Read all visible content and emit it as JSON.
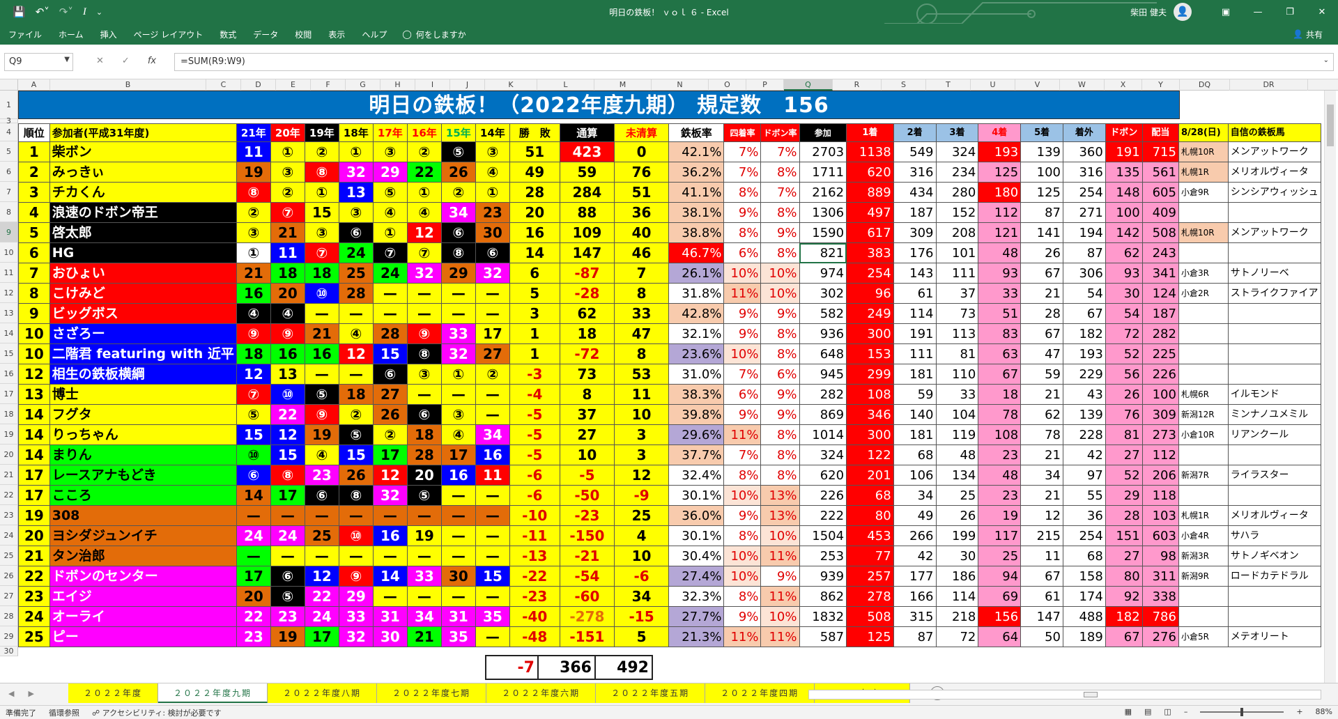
{
  "window": {
    "title": "明日の鉄板！ ｖｏｌ ６ - Excel",
    "user": "柴田 健夫",
    "qat_icons": [
      "save-icon",
      "undo-icon",
      "redo-icon",
      "italic-icon",
      "customize-icon"
    ]
  },
  "ribbon": {
    "tabs": [
      "ファイル",
      "ホーム",
      "挿入",
      "ページ レイアウト",
      "数式",
      "データ",
      "校閲",
      "表示",
      "ヘルプ"
    ],
    "tell_me": "何をしますか",
    "share": "共有"
  },
  "formula_bar": {
    "name_box": "Q9",
    "formula": "=SUM(R9:W9)"
  },
  "columns": [
    "A",
    "B",
    "C",
    "D",
    "E",
    "F",
    "G",
    "H",
    "I",
    "J",
    "K",
    "L",
    "M",
    "N",
    "O",
    "P",
    "Q",
    "R",
    "S",
    "T",
    "U",
    "V",
    "W",
    "X",
    "Y",
    "DQ",
    "DR"
  ],
  "rows": [
    "1",
    "3",
    "4",
    "5",
    "6",
    "7",
    "8",
    "9",
    "10",
    "11",
    "12",
    "13",
    "14",
    "15",
    "16",
    "17",
    "18",
    "19",
    "20",
    "21",
    "22",
    "23",
    "24",
    "25",
    "26",
    "27",
    "28",
    "29",
    "30"
  ],
  "sheet": {
    "banner": "明日の鉄板！（2022年度九期）  規定数　156",
    "headers": [
      "順位",
      "参加者(平成31年度)",
      "21年",
      "20年",
      "19年",
      "18年",
      "17年",
      "16年",
      "15年",
      "14年",
      "勝　敗",
      "通算",
      "未清算",
      "鉄板率",
      "四着率",
      "ドボン率",
      "参加",
      "1着",
      "2着",
      "3着",
      "4着",
      "5着",
      "着外",
      "ドボン",
      "配当",
      "8/28(日)",
      "自信の鉄板馬"
    ],
    "rows": [
      [
        "1",
        "柴ボン",
        "11",
        "①",
        "②",
        "①",
        "③",
        "②",
        "⑤",
        "③",
        "51",
        "423",
        "0",
        "42.1%",
        "7%",
        "7%",
        "2703",
        "1138",
        "549",
        "324",
        "193",
        "139",
        "360",
        "191",
        "715",
        "札幌10R",
        "メンアットワーク"
      ],
      [
        "2",
        "みっきぃ",
        "19",
        "③",
        "⑧",
        "32",
        "29",
        "22",
        "26",
        "④",
        "49",
        "59",
        "76",
        "36.2%",
        "7%",
        "8%",
        "1711",
        "620",
        "316",
        "234",
        "125",
        "100",
        "316",
        "135",
        "561",
        "札幌1R",
        "メリオルヴィータ"
      ],
      [
        "3",
        "チカくん",
        "⑧",
        "②",
        "①",
        "13",
        "⑤",
        "①",
        "②",
        "①",
        "28",
        "284",
        "51",
        "41.1%",
        "8%",
        "7%",
        "2162",
        "889",
        "434",
        "280",
        "180",
        "125",
        "254",
        "148",
        "605",
        "小倉9R",
        "シンシアウィッシュ"
      ],
      [
        "4",
        "浪速のドボン帝王",
        "②",
        "⑦",
        "15",
        "③",
        "④",
        "④",
        "34",
        "23",
        "20",
        "88",
        "36",
        "38.1%",
        "9%",
        "8%",
        "1306",
        "497",
        "187",
        "152",
        "112",
        "87",
        "271",
        "100",
        "409",
        "",
        ""
      ],
      [
        "5",
        "啓太郎",
        "③",
        "21",
        "③",
        "⑥",
        "①",
        "12",
        "⑥",
        "30",
        "16",
        "109",
        "40",
        "38.8%",
        "8%",
        "9%",
        "1590",
        "617",
        "309",
        "208",
        "121",
        "141",
        "194",
        "142",
        "508",
        "札幌10R",
        "メンアットワーク"
      ],
      [
        "6",
        "HG",
        "①",
        "11",
        "⑦",
        "24",
        "⑦",
        "⑦",
        "⑧",
        "⑥",
        "14",
        "147",
        "46",
        "46.7%",
        "6%",
        "8%",
        "821",
        "383",
        "176",
        "101",
        "48",
        "26",
        "87",
        "62",
        "243",
        "",
        ""
      ],
      [
        "7",
        "おひょい",
        "21",
        "18",
        "18",
        "25",
        "24",
        "32",
        "29",
        "32",
        "6",
        "-87",
        "7",
        "26.1%",
        "10%",
        "10%",
        "974",
        "254",
        "143",
        "111",
        "93",
        "67",
        "306",
        "93",
        "341",
        "小倉3R",
        "サトノリーベ"
      ],
      [
        "8",
        "こけみど",
        "16",
        "20",
        "⑩",
        "28",
        "—",
        "—",
        "—",
        "—",
        "5",
        "-28",
        "8",
        "31.8%",
        "11%",
        "10%",
        "302",
        "96",
        "61",
        "37",
        "33",
        "21",
        "54",
        "30",
        "124",
        "小倉2R",
        "ストライクファイア"
      ],
      [
        "9",
        "ビッグボス",
        "④",
        "④",
        "—",
        "—",
        "—",
        "—",
        "—",
        "—",
        "3",
        "62",
        "33",
        "42.8%",
        "9%",
        "9%",
        "582",
        "249",
        "114",
        "73",
        "51",
        "28",
        "67",
        "54",
        "187",
        "",
        ""
      ],
      [
        "10",
        "さざろー",
        "⑨",
        "⑨",
        "21",
        "④",
        "28",
        "⑨",
        "33",
        "17",
        "1",
        "18",
        "47",
        "32.1%",
        "9%",
        "8%",
        "936",
        "300",
        "191",
        "113",
        "83",
        "67",
        "182",
        "72",
        "282",
        "",
        ""
      ],
      [
        "10",
        "二階君 featuring with 近平",
        "18",
        "16",
        "16",
        "12",
        "15",
        "⑧",
        "32",
        "27",
        "1",
        "-72",
        "8",
        "23.6%",
        "10%",
        "8%",
        "648",
        "153",
        "111",
        "81",
        "63",
        "47",
        "193",
        "52",
        "225",
        "",
        ""
      ],
      [
        "12",
        "相生の鉄板横綱",
        "12",
        "13",
        "—",
        "—",
        "⑥",
        "③",
        "①",
        "②",
        "-3",
        "73",
        "53",
        "31.0%",
        "7%",
        "6%",
        "945",
        "299",
        "181",
        "110",
        "67",
        "59",
        "229",
        "56",
        "226",
        "",
        ""
      ],
      [
        "13",
        "博士",
        "⑦",
        "⑩",
        "⑤",
        "18",
        "27",
        "—",
        "—",
        "—",
        "-4",
        "8",
        "11",
        "38.3%",
        "6%",
        "9%",
        "282",
        "108",
        "59",
        "33",
        "18",
        "21",
        "43",
        "26",
        "100",
        "札幌6R",
        "イルモンド"
      ],
      [
        "14",
        "フグタ",
        "⑤",
        "22",
        "⑨",
        "②",
        "26",
        "⑥",
        "③",
        "—",
        "-5",
        "37",
        "10",
        "39.8%",
        "9%",
        "9%",
        "869",
        "346",
        "140",
        "104",
        "78",
        "62",
        "139",
        "76",
        "309",
        "新潟12R",
        "ミンナノユメミル"
      ],
      [
        "14",
        "りっちゃん",
        "15",
        "12",
        "19",
        "⑤",
        "②",
        "18",
        "④",
        "34",
        "-5",
        "27",
        "3",
        "29.6%",
        "11%",
        "8%",
        "1014",
        "300",
        "181",
        "119",
        "108",
        "78",
        "228",
        "81",
        "273",
        "小倉10R",
        "リアンクール"
      ],
      [
        "14",
        "まりん",
        "⑩",
        "15",
        "④",
        "15",
        "17",
        "28",
        "17",
        "16",
        "-5",
        "10",
        "3",
        "37.7%",
        "7%",
        "8%",
        "324",
        "122",
        "68",
        "48",
        "23",
        "21",
        "42",
        "27",
        "112",
        "",
        ""
      ],
      [
        "17",
        "レースアナもどき",
        "⑥",
        "⑧",
        "23",
        "26",
        "12",
        "20",
        "16",
        "11",
        "-6",
        "-5",
        "12",
        "32.4%",
        "8%",
        "8%",
        "620",
        "201",
        "106",
        "134",
        "48",
        "34",
        "97",
        "52",
        "206",
        "新潟7R",
        "ライラスター"
      ],
      [
        "17",
        "こころ",
        "14",
        "17",
        "⑥",
        "⑧",
        "32",
        "⑤",
        "—",
        "—",
        "-6",
        "-50",
        "-9",
        "30.1%",
        "10%",
        "13%",
        "226",
        "68",
        "34",
        "25",
        "23",
        "21",
        "55",
        "29",
        "118",
        "",
        ""
      ],
      [
        "19",
        "308",
        "—",
        "—",
        "—",
        "—",
        "—",
        "—",
        "—",
        "—",
        "-10",
        "-23",
        "25",
        "36.0%",
        "9%",
        "13%",
        "222",
        "80",
        "49",
        "26",
        "19",
        "12",
        "36",
        "28",
        "103",
        "札幌1R",
        "メリオルヴィータ"
      ],
      [
        "20",
        "ヨシダジュンイチ",
        "24",
        "24",
        "25",
        "⑩",
        "16",
        "19",
        "—",
        "—",
        "-11",
        "-150",
        "4",
        "30.1%",
        "8%",
        "10%",
        "1504",
        "453",
        "266",
        "199",
        "117",
        "215",
        "254",
        "151",
        "603",
        "小倉4R",
        "サハラ"
      ],
      [
        "21",
        "タン治郎",
        "—",
        "—",
        "—",
        "—",
        "—",
        "—",
        "—",
        "—",
        "-13",
        "-21",
        "10",
        "30.4%",
        "10%",
        "11%",
        "253",
        "77",
        "42",
        "30",
        "25",
        "11",
        "68",
        "27",
        "98",
        "新潟3R",
        "サトノギベオン"
      ],
      [
        "22",
        "ドボンのセンター",
        "17",
        "⑥",
        "12",
        "⑨",
        "14",
        "33",
        "30",
        "15",
        "-22",
        "-54",
        "-6",
        "27.4%",
        "10%",
        "9%",
        "939",
        "257",
        "177",
        "186",
        "94",
        "67",
        "158",
        "80",
        "311",
        "新潟9R",
        "ロードカテドラル"
      ],
      [
        "23",
        "エイジ",
        "20",
        "⑤",
        "22",
        "29",
        "—",
        "—",
        "—",
        "—",
        "-23",
        "-60",
        "34",
        "32.3%",
        "8%",
        "11%",
        "862",
        "278",
        "166",
        "114",
        "69",
        "61",
        "174",
        "92",
        "338",
        "",
        ""
      ],
      [
        "24",
        "オーライ",
        "22",
        "23",
        "24",
        "33",
        "31",
        "34",
        "31",
        "35",
        "-40",
        "-278",
        "-15",
        "27.7%",
        "9%",
        "10%",
        "1832",
        "508",
        "315",
        "218",
        "156",
        "147",
        "488",
        "182",
        "786",
        "",
        ""
      ],
      [
        "25",
        "ピー",
        "23",
        "19",
        "17",
        "32",
        "30",
        "21",
        "35",
        "—",
        "-48",
        "-151",
        "5",
        "21.3%",
        "11%",
        "11%",
        "587",
        "125",
        "87",
        "72",
        "64",
        "50",
        "189",
        "67",
        "276",
        "小倉5R",
        "メテオリート"
      ]
    ],
    "totals": [
      "-7",
      "366",
      "492"
    ]
  },
  "sheet_tabs": [
    "２０２２年度",
    "２０２２年度九期",
    "２０２２年度八期",
    "２０２２年度七期",
    "２０２２年度六期",
    "２０２２年度五期",
    "２０２２年度四期",
    "２０２２年度三..."
  ],
  "sheet_tab_more": "...",
  "status": {
    "left": [
      "準備完了",
      "循環参照",
      "アクセシビリティ: 検討が必要です"
    ],
    "zoom": "88%"
  }
}
